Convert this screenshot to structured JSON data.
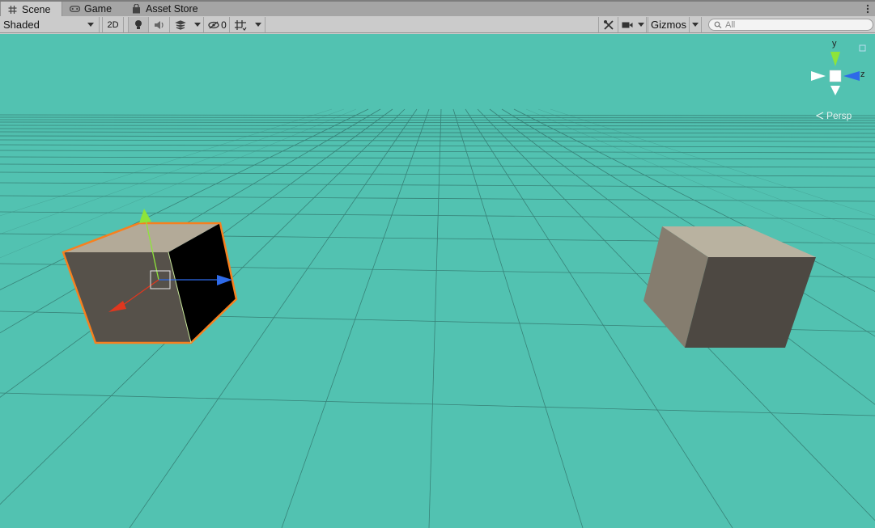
{
  "tabs": [
    {
      "label": "Scene",
      "icon": "grid-icon",
      "active": true
    },
    {
      "label": "Game",
      "icon": "gamepad-icon",
      "active": false
    },
    {
      "label": "Asset Store",
      "icon": "bag-icon",
      "active": false
    }
  ],
  "toolbar": {
    "draw_mode": "Shaded",
    "mode_2d": "2D",
    "hidden_count": "0",
    "gizmos_label": "Gizmos",
    "search_placeholder": "All"
  },
  "orientation_gizmo": {
    "y_label": "y",
    "z_label": "z",
    "projection": "Persp"
  },
  "colors": {
    "sky": "#52c2b1",
    "selection_outline": "#f7801f",
    "x_axis": "#e0371e",
    "y_axis": "#8ee43a",
    "z_axis": "#2e6ae8"
  }
}
